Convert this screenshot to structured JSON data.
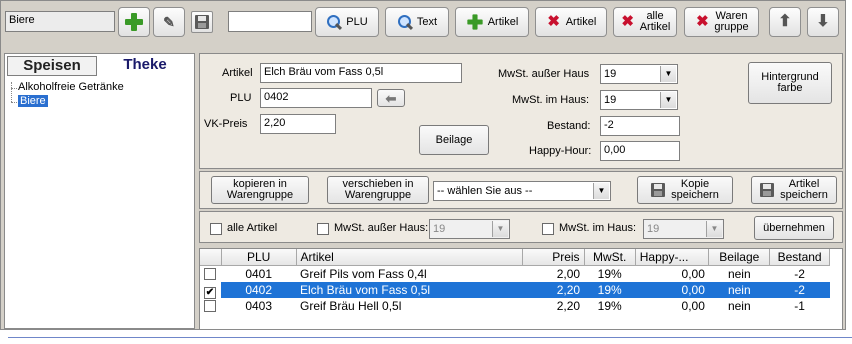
{
  "toolbar": {
    "group_value": "Biere",
    "search_value": "",
    "plu_label": "PLU",
    "text_label": "Text",
    "add_article_label": "Artikel",
    "delete_article_label": "Artikel",
    "delete_all_label": "alle\nArtikel",
    "delete_group_label": "Waren\ngruppe"
  },
  "tabs": {
    "speisen": "Speisen",
    "theke": "Theke"
  },
  "tree": {
    "items": [
      "Alkoholfreie Getränke",
      "Biere"
    ]
  },
  "form": {
    "artikel_label": "Artikel",
    "artikel_value": "Elch Bräu vom Fass 0,5l",
    "plu_label": "PLU",
    "plu_value": "0402",
    "vk_label": "VK-Preis",
    "vk_value": "2,20",
    "beilage_label": "Beilage",
    "mwst_ausser_label": "MwSt. außer Haus",
    "mwst_ausser_value": "19",
    "mwst_im_label": "MwSt. im Haus:",
    "mwst_im_value": "19",
    "bestand_label": "Bestand:",
    "bestand_value": "-2",
    "happy_label": "Happy-Hour:",
    "happy_value": "0,00",
    "hintergrund_label": "Hintergrund\nfarbe"
  },
  "actions": {
    "kopieren_label": "kopieren in\nWarengruppe",
    "verschieben_label": "verschieben in\nWarengruppe",
    "warengruppe_select": "-- wählen Sie aus --",
    "kopie_label": "Kopie\nspeichern",
    "artikel_speichern_label": "Artikel\nspeichern"
  },
  "filters": {
    "alle_label": "alle Artikel",
    "mwst_ausser_label": "MwSt. außer Haus:",
    "mwst_ausser_value": "19",
    "mwst_im_label": "MwSt. im Haus:",
    "mwst_im_value": "19",
    "uebernehmen_label": "übernehmen"
  },
  "table": {
    "columns": [
      "PLU",
      "Artikel",
      "Preis",
      "MwSt.",
      "Happy-...",
      "Beilage",
      "Bestand"
    ],
    "rows": [
      {
        "checked": false,
        "selected": false,
        "plu": "0401",
        "artikel": "Greif Pils vom Fass 0,4l",
        "preis": "2,00",
        "mwst": "19%",
        "happy": "0,00",
        "beilage": "nein",
        "bestand": "-2"
      },
      {
        "checked": true,
        "selected": true,
        "plu": "0402",
        "artikel": "Elch Bräu vom Fass 0,5l",
        "preis": "2,20",
        "mwst": "19%",
        "happy": "0,00",
        "beilage": "nein",
        "bestand": "-2"
      },
      {
        "checked": false,
        "selected": false,
        "plu": "0403",
        "artikel": "Greif Bräu Hell 0,5l",
        "preis": "2,20",
        "mwst": "19%",
        "happy": "0,00",
        "beilage": "nein",
        "bestand": "-1"
      }
    ]
  },
  "colors": {
    "selection": "#1e73d6",
    "accent_line": "#6f86c9"
  }
}
